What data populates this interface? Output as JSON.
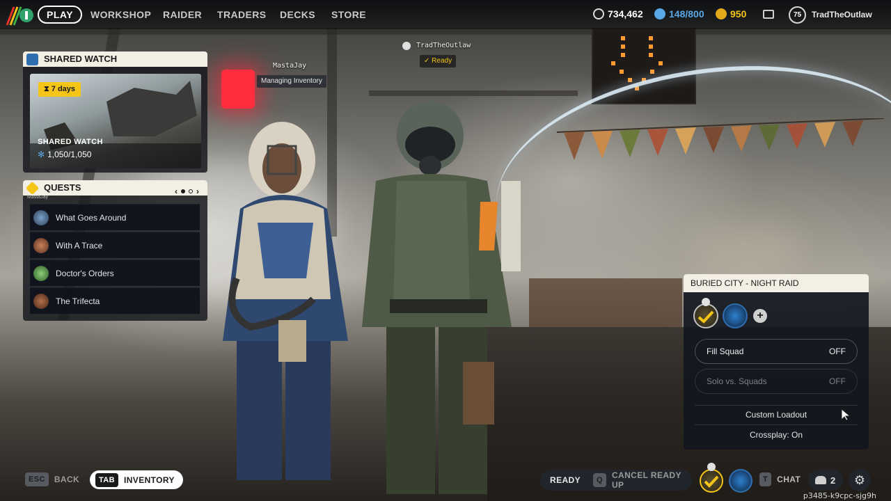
{
  "nav": {
    "play": "PLAY",
    "items": [
      "WORKSHOP",
      "RAIDER",
      "TRADERS",
      "DECKS",
      "STORE"
    ]
  },
  "currencies": {
    "coins": "734,462",
    "tickets": "148/800",
    "credits": "950"
  },
  "player": {
    "level": "75",
    "name": "TradTheOutlaw"
  },
  "shared_watch": {
    "title": "SHARED WATCH",
    "duration": "7 days",
    "card_title": "SHARED WATCH",
    "progress": "1,050/1,050"
  },
  "quests": {
    "title": "QUESTS",
    "small_tag": "MastaJay",
    "items": [
      {
        "label": "What Goes Around"
      },
      {
        "label": "With A Trace"
      },
      {
        "label": "Doctor's Orders"
      },
      {
        "label": "The Trifecta"
      }
    ]
  },
  "teammates": {
    "left": {
      "name": "MastaJay",
      "status": "Managing Inventory"
    },
    "right": {
      "name": "TradTheOutlaw",
      "status": "Ready"
    }
  },
  "raid": {
    "title": "BURIED CITY - NIGHT RAID",
    "fill_squad_label": "Fill Squad",
    "fill_squad_value": "OFF",
    "solo_label": "Solo vs. Squads",
    "solo_value": "OFF",
    "custom_loadout": "Custom Loadout",
    "crossplay": "Crossplay: On"
  },
  "bottom": {
    "esc_key": "ESC",
    "back": "BACK",
    "tab_key": "TAB",
    "inventory": "INVENTORY",
    "ready": "READY",
    "q_key": "Q",
    "cancel_ready": "CANCEL READY UP",
    "t_key": "T",
    "chat": "CHAT",
    "party_count": "2",
    "session_id": "p3485-k9cpc-sjg9h"
  },
  "colors": {
    "accent_yellow": "#f5c518",
    "panel_header": "#f3efe5",
    "ready_green": "#e8c33b",
    "currency_blue": "#5aa7e6"
  }
}
